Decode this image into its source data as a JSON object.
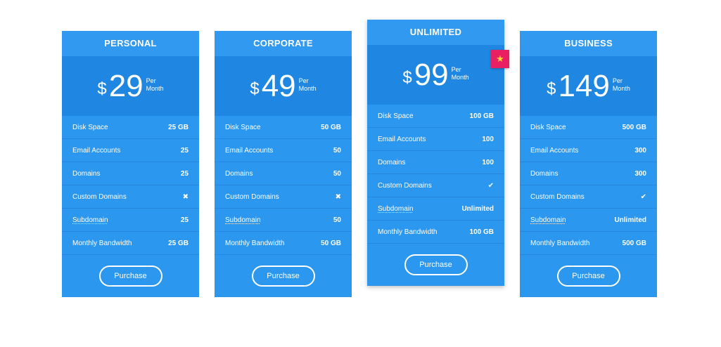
{
  "plans": [
    {
      "name": "PERSONAL",
      "currency": "$",
      "price": "29",
      "period": "Per\nMonth",
      "features": [
        {
          "label": "Disk Space",
          "value": "25 GB"
        },
        {
          "label": "Email Accounts",
          "value": "25"
        },
        {
          "label": "Domains",
          "value": "25"
        },
        {
          "label": "Custom Domains",
          "value": "✖"
        },
        {
          "label": "Subdomain",
          "value": "25"
        },
        {
          "label": "Monthly Bandwidth",
          "value": "25 GB"
        }
      ],
      "button": "Purchase"
    },
    {
      "name": "CORPORATE",
      "currency": "$",
      "price": "49",
      "period": "Per\nMonth",
      "features": [
        {
          "label": "Disk Space",
          "value": "50 GB"
        },
        {
          "label": "Email Accounts",
          "value": "50"
        },
        {
          "label": "Domains",
          "value": "50"
        },
        {
          "label": "Custom Domains",
          "value": "✖"
        },
        {
          "label": "Subdomain",
          "value": "50"
        },
        {
          "label": "Monthly Bandwidth",
          "value": "50 GB"
        }
      ],
      "button": "Purchase"
    },
    {
      "name": "UNLIMITED",
      "currency": "$",
      "price": "99",
      "period": "Per\nMonth",
      "features": [
        {
          "label": "Disk Space",
          "value": "100 GB"
        },
        {
          "label": "Email Accounts",
          "value": "100"
        },
        {
          "label": "Domains",
          "value": "100"
        },
        {
          "label": "Custom Domains",
          "value": "✔"
        },
        {
          "label": "Subdomain",
          "value": "Unlimited"
        },
        {
          "label": "Monthly Bandwidth",
          "value": "100 GB"
        }
      ],
      "button": "Purchase",
      "badge": "★"
    },
    {
      "name": "BUSINESS",
      "currency": "$",
      "price": "149",
      "period": "Per\nMonth",
      "features": [
        {
          "label": "Disk Space",
          "value": "500 GB"
        },
        {
          "label": "Email Accounts",
          "value": "300"
        },
        {
          "label": "Domains",
          "value": "300"
        },
        {
          "label": "Custom Domains",
          "value": "✔"
        },
        {
          "label": "Subdomain",
          "value": "Unlimited"
        },
        {
          "label": "Monthly Bandwidth",
          "value": "500 GB"
        }
      ],
      "button": "Purchase"
    }
  ],
  "colors": {
    "card": "#2c97ee",
    "price_band": "#1f87e2",
    "badge": "#ea1e63",
    "star": "#ffd23b"
  }
}
